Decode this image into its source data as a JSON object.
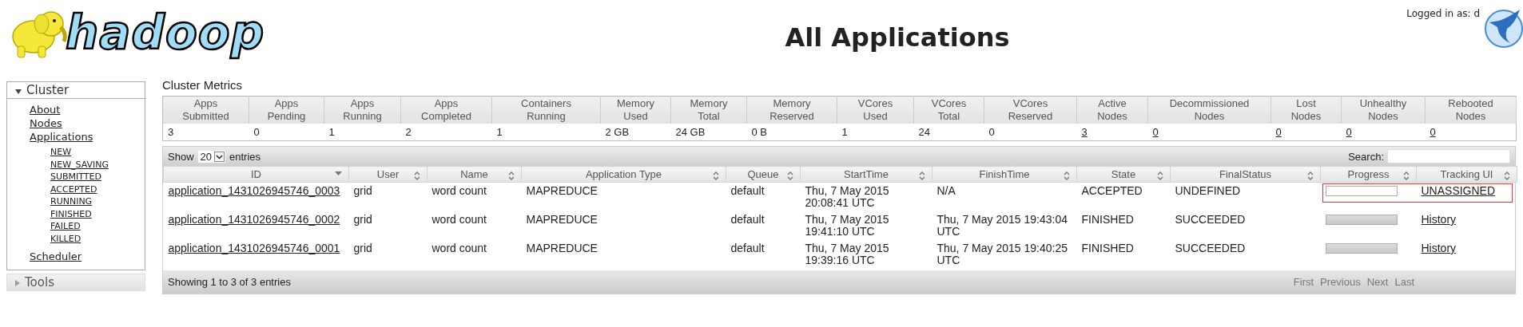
{
  "header": {
    "logo_text": "hadoop",
    "title": "All Applications",
    "login": "Logged in as: d"
  },
  "sidebar": {
    "sections": [
      {
        "label": "Cluster",
        "expanded": true,
        "items": [
          {
            "label": "About"
          },
          {
            "label": "Nodes"
          },
          {
            "label": "Applications",
            "children": [
              {
                "label": "NEW"
              },
              {
                "label": "NEW_SAVING"
              },
              {
                "label": "SUBMITTED"
              },
              {
                "label": "ACCEPTED"
              },
              {
                "label": "RUNNING"
              },
              {
                "label": "FINISHED"
              },
              {
                "label": "FAILED"
              },
              {
                "label": "KILLED"
              }
            ]
          },
          {
            "label": "Scheduler"
          }
        ]
      },
      {
        "label": "Tools",
        "expanded": false
      }
    ]
  },
  "metrics": {
    "title": "Cluster Metrics",
    "columns": [
      {
        "lines": [
          "Apps",
          "Submitted"
        ],
        "value": "3",
        "link": false
      },
      {
        "lines": [
          "Apps",
          "Pending"
        ],
        "value": "0",
        "link": false
      },
      {
        "lines": [
          "Apps",
          "Running"
        ],
        "value": "1",
        "link": false
      },
      {
        "lines": [
          "Apps",
          "Completed"
        ],
        "value": "2",
        "link": false
      },
      {
        "lines": [
          "Containers",
          "Running"
        ],
        "value": "1",
        "link": false
      },
      {
        "lines": [
          "Memory",
          "Used"
        ],
        "value": "2 GB",
        "link": false
      },
      {
        "lines": [
          "Memory",
          "Total"
        ],
        "value": "24 GB",
        "link": false
      },
      {
        "lines": [
          "Memory",
          "Reserved"
        ],
        "value": "0 B",
        "link": false
      },
      {
        "lines": [
          "VCores",
          "Used"
        ],
        "value": "1",
        "link": false
      },
      {
        "lines": [
          "VCores",
          "Total"
        ],
        "value": "24",
        "link": false
      },
      {
        "lines": [
          "VCores",
          "Reserved"
        ],
        "value": "0",
        "link": false
      },
      {
        "lines": [
          "Active",
          "Nodes"
        ],
        "value": "3",
        "link": true
      },
      {
        "lines": [
          "Decommissioned",
          "Nodes"
        ],
        "value": "0",
        "link": true
      },
      {
        "lines": [
          "Lost",
          "Nodes"
        ],
        "value": "0",
        "link": true
      },
      {
        "lines": [
          "Unhealthy",
          "Nodes"
        ],
        "value": "0",
        "link": true
      },
      {
        "lines": [
          "Rebooted",
          "Nodes"
        ],
        "value": "0",
        "link": true
      }
    ]
  },
  "applications": {
    "show_label": "Show",
    "page_size": "20",
    "entries_label": "entries",
    "search_label": "Search:",
    "columns": [
      {
        "label": "ID",
        "kind": "descending"
      },
      {
        "label": "User",
        "kind": "sortable"
      },
      {
        "label": "Name",
        "kind": "sortable"
      },
      {
        "label": "Application Type",
        "kind": "sortable"
      },
      {
        "label": "Queue",
        "kind": "sortable"
      },
      {
        "label": "StartTime",
        "kind": "sortable"
      },
      {
        "label": "FinishTime",
        "kind": "sortable"
      },
      {
        "label": "State",
        "kind": "sortable"
      },
      {
        "label": "FinalStatus",
        "kind": "sortable"
      },
      {
        "label": "Progress",
        "kind": "sortable"
      },
      {
        "label": "Tracking UI",
        "kind": "sortable"
      }
    ],
    "rows": [
      {
        "id": "application_1431026945746_0003",
        "user": "grid",
        "name": "word count",
        "type": "MAPREDUCE",
        "queue": "default",
        "start": "Thu, 7 May 2015 20:08:41 UTC",
        "finish": "N/A",
        "state": "ACCEPTED",
        "final_status": "UNDEFINED",
        "level": 0,
        "tracking": "UNASSIGNED",
        "highlighted": true
      },
      {
        "id": "application_1431026945746_0002",
        "user": "grid",
        "name": "word count",
        "type": "MAPREDUCE",
        "queue": "default",
        "start": "Thu, 7 May 2015 19:41:10 UTC",
        "finish": "Thu, 7 May 2015 19:43:04 UTC",
        "state": "FINISHED",
        "final_status": "SUCCEEDED",
        "level": 1,
        "tracking": "History",
        "highlighted": false
      },
      {
        "id": "application_1431026945746_0001",
        "user": "grid",
        "name": "word count",
        "type": "MAPREDUCE",
        "queue": "default",
        "start": "Thu, 7 May 2015 19:39:16 UTC",
        "finish": "Thu, 7 May 2015 19:40:25 UTC",
        "state": "FINISHED",
        "final_status": "SUCCEEDED",
        "level": 1,
        "tracking": "History",
        "highlighted": false
      }
    ],
    "info": "Showing 1 to 3 of 3 entries",
    "pagination": [
      {
        "label": "First",
        "disabled": true
      },
      {
        "label": "Previous",
        "disabled": true
      },
      {
        "label": "Next",
        "disabled": true
      },
      {
        "label": "Last",
        "disabled": true
      }
    ]
  }
}
